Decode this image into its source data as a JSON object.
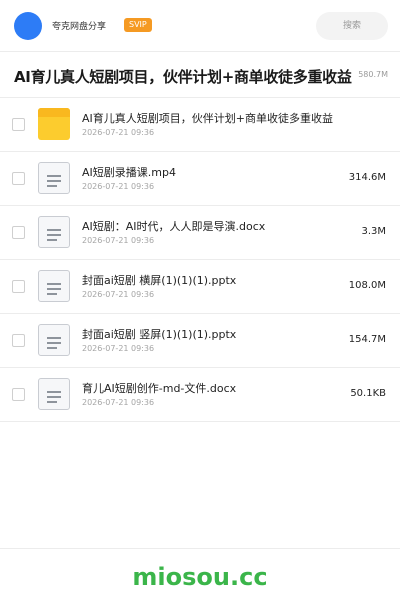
{
  "header": {
    "brand": "夸克网盘分享",
    "badge": "SVIP",
    "search_placeholder": "搜索"
  },
  "share": {
    "title": "AI育儿真人短剧项目，伙伴计划+商单收徒多重收益",
    "total_size": "580.7M"
  },
  "files": [
    {
      "name": "AI育儿真人短剧项目，伙伴计划+商单收徒多重收益",
      "date": "2026-07-21 09:36",
      "size": "",
      "icon": "folder-icon"
    },
    {
      "name": "AI短剧录播课.mp4",
      "date": "2026-07-21 09:36",
      "size": "314.6M",
      "icon": "document-icon"
    },
    {
      "name": "AI短剧：AI时代，人人即是导演.docx",
      "date": "2026-07-21 09:36",
      "size": "3.3M",
      "icon": "document-icon"
    },
    {
      "name": "封面ai短剧 横屏(1)(1)(1).pptx",
      "date": "2026-07-21 09:36",
      "size": "108.0M",
      "icon": "document-icon"
    },
    {
      "name": "封面ai短剧 竖屏(1)(1)(1).pptx",
      "date": "2026-07-21 09:36",
      "size": "154.7M",
      "icon": "document-icon"
    },
    {
      "name": "育儿AI短剧创作-md-文件.docx",
      "date": "2026-07-21 09:36",
      "size": "50.1KB",
      "icon": "document-icon"
    }
  ],
  "footer": {
    "brand": "miosou.cc"
  },
  "colors": {
    "accent_blue": "#2d7cf6",
    "svip_orange": "#f59a23",
    "folder_yellow": "#fccc2e",
    "footer_green": "#3bb54a"
  }
}
